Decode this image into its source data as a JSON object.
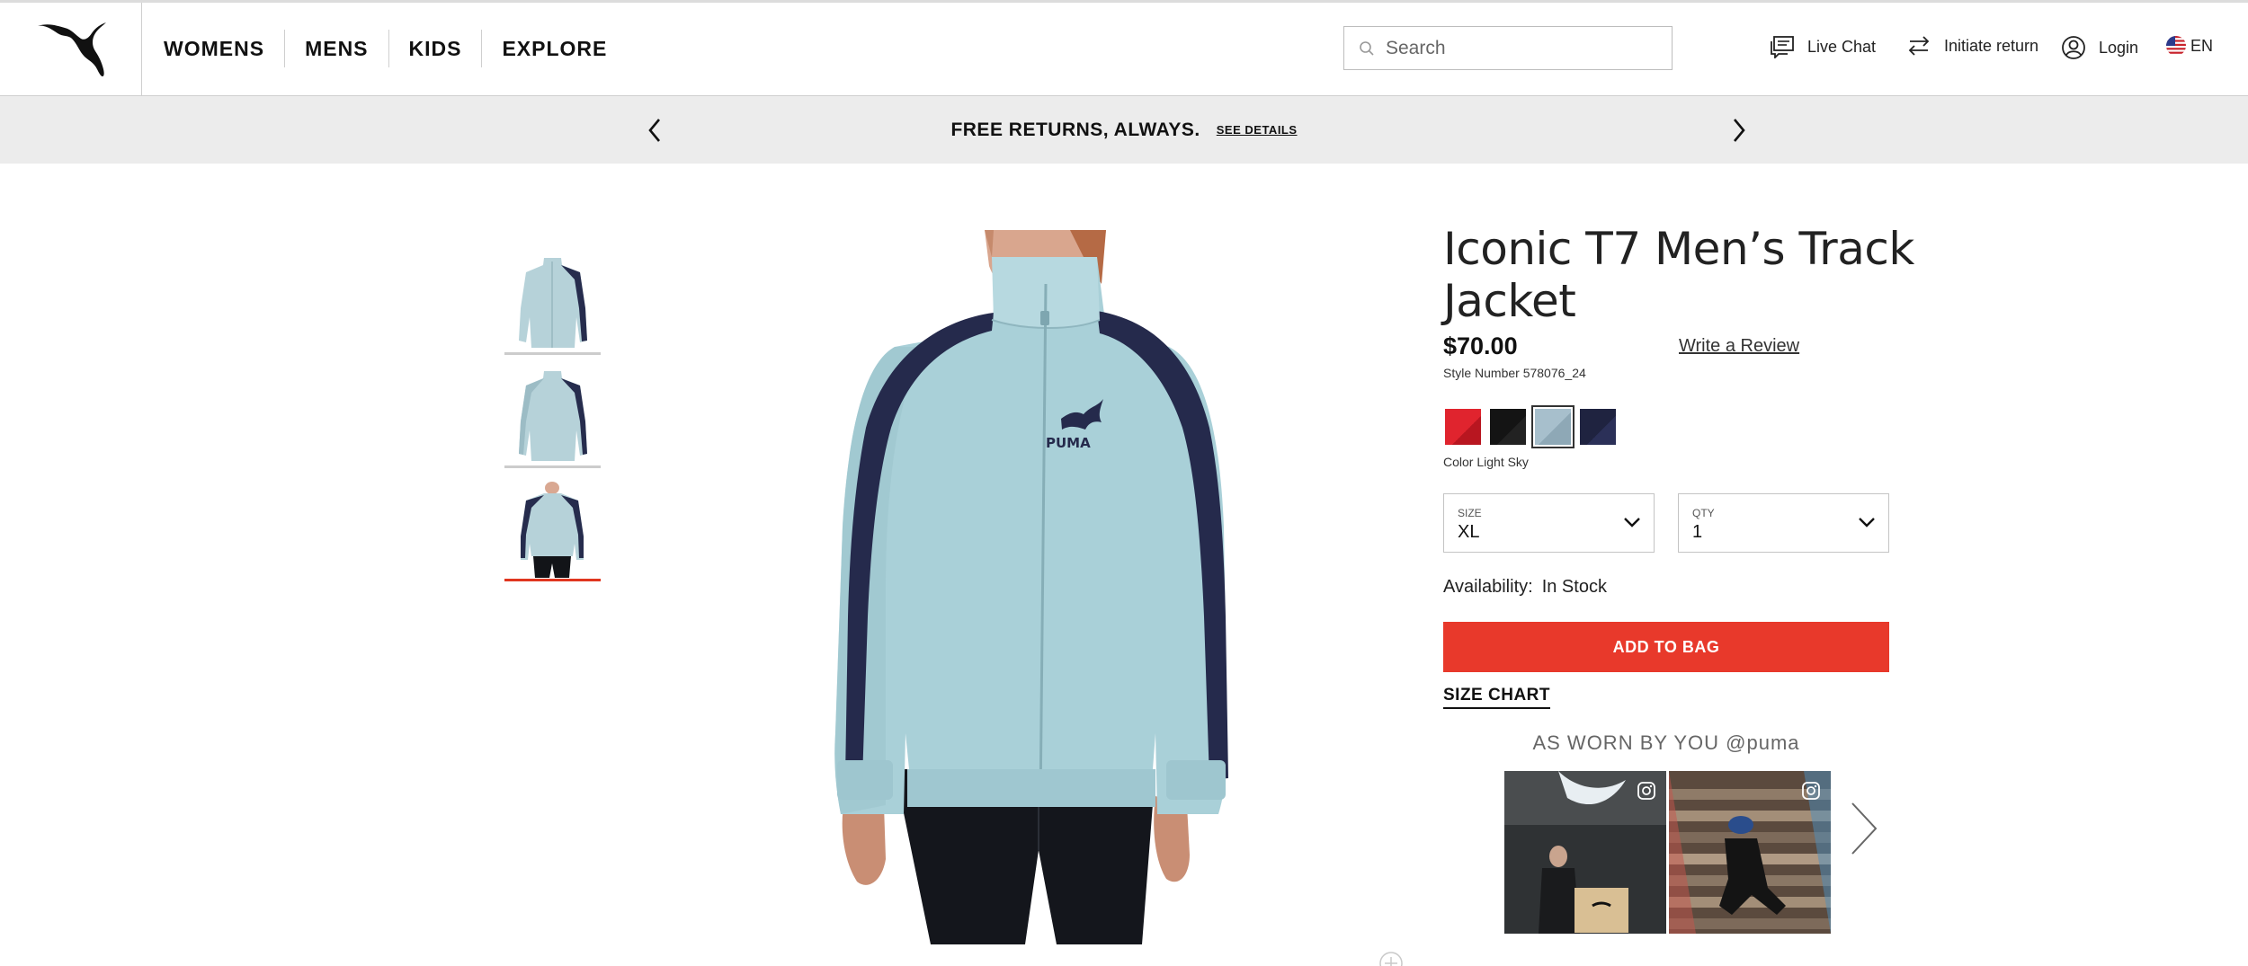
{
  "header": {
    "nav": [
      "WOMENS",
      "MENS",
      "KIDS",
      "EXPLORE"
    ],
    "search_placeholder": "Search",
    "live_chat": "Live Chat",
    "initiate_return": "Initiate return",
    "login": "Login",
    "language": "EN"
  },
  "promo": {
    "text": "FREE RETURNS, ALWAYS.",
    "link": "SEE DETAILS"
  },
  "product": {
    "title": "Iconic T7 Men’s Track Jacket",
    "price": "$70.00",
    "review_link": "Write a Review",
    "style_number": "Style Number 578076_24",
    "color_label": "Color Light Sky",
    "swatches": [
      "#e0242e",
      "#141414",
      "#a7bfcc",
      "#1f2340"
    ],
    "size": {
      "label": "SIZE",
      "value": "XL"
    },
    "qty": {
      "label": "QTY",
      "value": "1"
    },
    "availability_label": "Availability:",
    "availability_value": "In Stock",
    "add_to_bag": "ADD TO BAG",
    "size_chart": "SIZE CHART"
  },
  "ugc": {
    "title": "AS WORN BY YOU @puma"
  },
  "colors": {
    "accent": "#e8392b",
    "promo_bg": "#ececec",
    "jacket": "#a9d0d8",
    "jacket_stripe": "#252a4c"
  },
  "icons": [
    "puma-logo",
    "search-icon",
    "chat-icon",
    "return-icon",
    "user-icon",
    "us-flag-icon",
    "chevron-left-icon",
    "chevron-right-icon",
    "chevron-down-icon",
    "instagram-icon",
    "zoom-icon"
  ]
}
